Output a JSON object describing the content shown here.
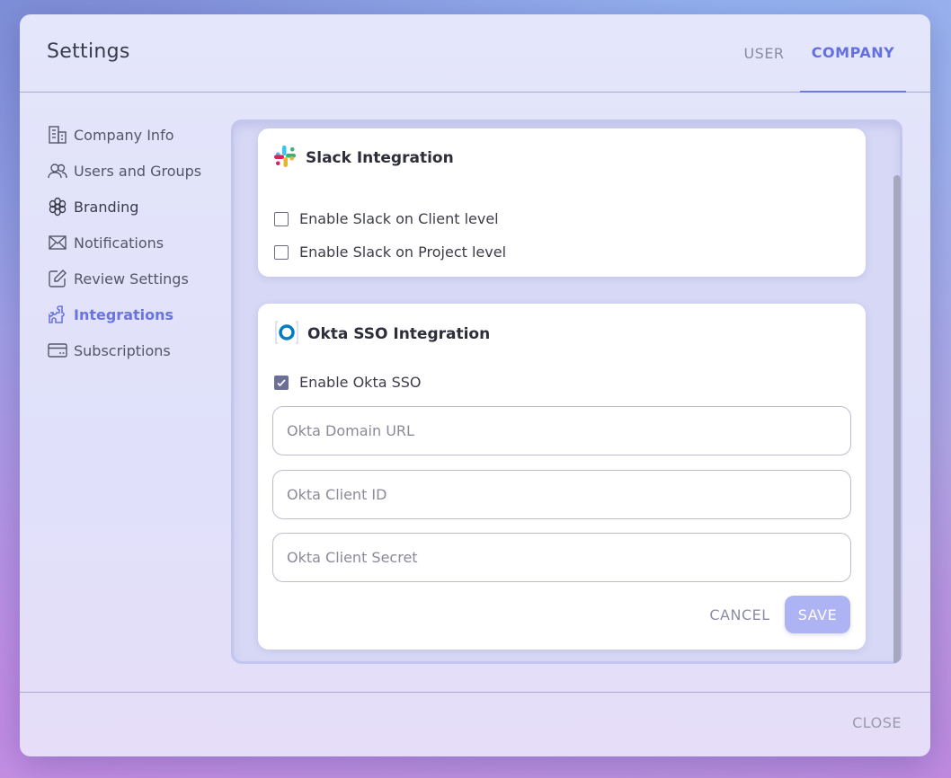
{
  "window": {
    "title": "Settings"
  },
  "tabs": [
    {
      "label": "USER",
      "active": false
    },
    {
      "label": "COMPANY",
      "active": true
    }
  ],
  "sidebar": {
    "items": [
      {
        "label": "Company Info",
        "icon": "building-icon"
      },
      {
        "label": "Users and Groups",
        "icon": "users-icon"
      },
      {
        "label": "Branding",
        "icon": "flower-icon"
      },
      {
        "label": "Notifications",
        "icon": "envelope-icon"
      },
      {
        "label": "Review Settings",
        "icon": "edit-icon"
      },
      {
        "label": "Integrations",
        "icon": "puzzle-icon",
        "active": true
      },
      {
        "label": "Subscriptions",
        "icon": "credit-card-icon"
      }
    ]
  },
  "slack": {
    "title": "Slack Integration",
    "options": [
      {
        "label": "Enable Slack on Client level",
        "checked": false
      },
      {
        "label": "Enable Slack on Project level",
        "checked": false
      }
    ]
  },
  "okta": {
    "title": "Okta SSO Integration",
    "enable_label": "Enable Okta SSO",
    "enable_checked": true,
    "fields": {
      "domain": {
        "placeholder": "Okta Domain URL",
        "value": ""
      },
      "client_id": {
        "placeholder": "Okta Client ID",
        "value": ""
      },
      "client_secret": {
        "placeholder": "Okta Client Secret",
        "value": ""
      }
    },
    "cancel_label": "CANCEL",
    "save_label": "SAVE"
  },
  "footer": {
    "close_label": "CLOSE"
  },
  "colors": {
    "accent": "#6570e0",
    "save_button": "#aeb3f3",
    "checkbox_checked": "#6b6e96"
  }
}
